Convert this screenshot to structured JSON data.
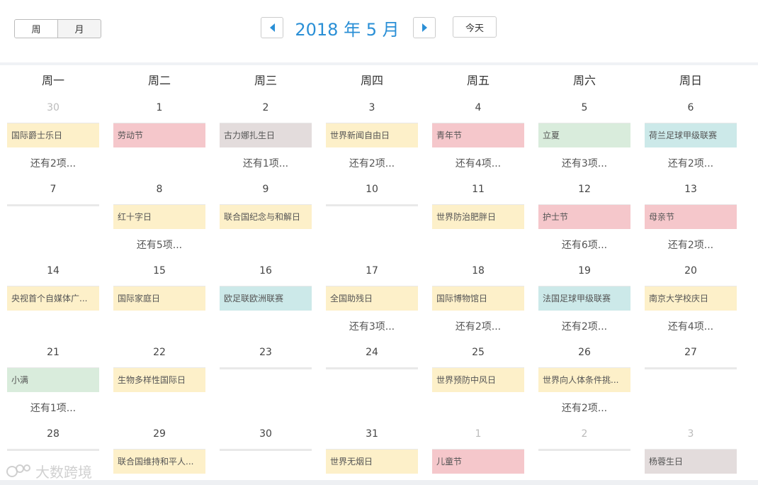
{
  "header": {
    "view_week": "周",
    "view_month": "月",
    "title": "2018 年 5 月",
    "today": "今天"
  },
  "weekdays": [
    "周一",
    "周二",
    "周三",
    "周四",
    "周五",
    "周六",
    "周日"
  ],
  "weeks": [
    {
      "days": [
        {
          "num": "30",
          "other": true,
          "event": {
            "text": "国际爵士乐日",
            "color": "yellow"
          },
          "more": "还有2项..."
        },
        {
          "num": "1",
          "event": {
            "text": "劳动节",
            "color": "red"
          }
        },
        {
          "num": "2",
          "event": {
            "text": "古力娜扎生日",
            "color": "gray"
          },
          "more": "还有1项..."
        },
        {
          "num": "3",
          "event": {
            "text": "世界新闻自由日",
            "color": "yellow"
          },
          "more": "还有2项..."
        },
        {
          "num": "4",
          "event": {
            "text": "青年节",
            "color": "red"
          },
          "more": "还有4项..."
        },
        {
          "num": "5",
          "event": {
            "text": "立夏",
            "color": "green"
          },
          "more": "还有3项..."
        },
        {
          "num": "6",
          "event": {
            "text": "荷兰足球甲级联赛",
            "color": "teal"
          },
          "more": "还有2项..."
        }
      ]
    },
    {
      "days": [
        {
          "num": "7"
        },
        {
          "num": "8",
          "event": {
            "text": "红十字日",
            "color": "yellow"
          },
          "more": "还有5项..."
        },
        {
          "num": "9",
          "event": {
            "text": "联合国纪念与和解日",
            "color": "yellow"
          }
        },
        {
          "num": "10"
        },
        {
          "num": "11",
          "event": {
            "text": "世界防治肥胖日",
            "color": "yellow"
          }
        },
        {
          "num": "12",
          "event": {
            "text": "护士节",
            "color": "red"
          },
          "more": "还有6项..."
        },
        {
          "num": "13",
          "event": {
            "text": "母亲节",
            "color": "red"
          },
          "more": "还有2项..."
        }
      ]
    },
    {
      "days": [
        {
          "num": "14",
          "event": {
            "text": "央视首个自媒体广...",
            "color": "yellow"
          }
        },
        {
          "num": "15",
          "event": {
            "text": "国际家庭日",
            "color": "yellow"
          }
        },
        {
          "num": "16",
          "event": {
            "text": "欧足联欧洲联赛",
            "color": "teal"
          }
        },
        {
          "num": "17",
          "event": {
            "text": "全国助残日",
            "color": "yellow"
          },
          "more": "还有3项..."
        },
        {
          "num": "18",
          "event": {
            "text": "国际博物馆日",
            "color": "yellow"
          },
          "more": "还有2项..."
        },
        {
          "num": "19",
          "event": {
            "text": "法国足球甲级联赛",
            "color": "teal"
          },
          "more": "还有2项..."
        },
        {
          "num": "20",
          "event": {
            "text": "南京大学校庆日",
            "color": "yellow"
          },
          "more": "还有4项..."
        }
      ]
    },
    {
      "days": [
        {
          "num": "21",
          "event": {
            "text": "小满",
            "color": "green"
          },
          "more": "还有1项..."
        },
        {
          "num": "22",
          "event": {
            "text": "生物多样性国际日",
            "color": "yellow"
          }
        },
        {
          "num": "23"
        },
        {
          "num": "24"
        },
        {
          "num": "25",
          "event": {
            "text": "世界预防中风日",
            "color": "yellow"
          }
        },
        {
          "num": "26",
          "event": {
            "text": "世界向人体条件挑...",
            "color": "yellow"
          },
          "more": "还有2项..."
        },
        {
          "num": "27"
        }
      ]
    },
    {
      "days": [
        {
          "num": "28"
        },
        {
          "num": "29",
          "event": {
            "text": "联合国维持和平人...",
            "color": "yellow"
          }
        },
        {
          "num": "30"
        },
        {
          "num": "31",
          "event": {
            "text": "世界无烟日",
            "color": "yellow"
          }
        },
        {
          "num": "1",
          "other": true,
          "event": {
            "text": "儿童节",
            "color": "red"
          }
        },
        {
          "num": "2",
          "other": true
        },
        {
          "num": "3",
          "other": true,
          "event": {
            "text": "杨蓉生日",
            "color": "gray"
          }
        }
      ]
    }
  ],
  "watermark": "大数跨境"
}
